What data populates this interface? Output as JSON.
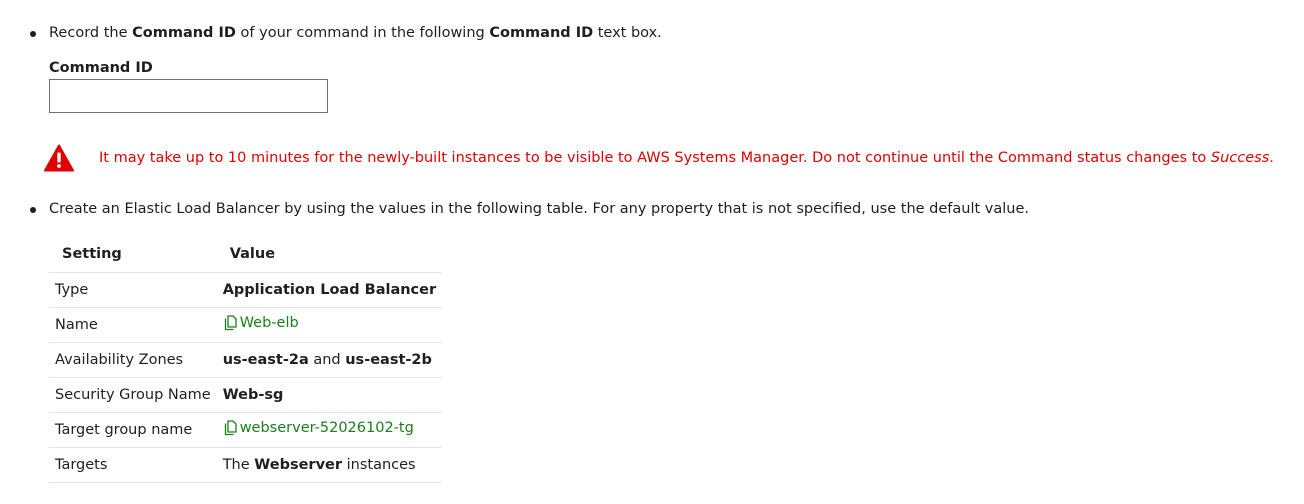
{
  "step1": {
    "t1": "Record the ",
    "b1": "Command ID",
    "t2": " of your command in the following ",
    "b2": "Command ID",
    "t3": " text box."
  },
  "field": {
    "label": "Command ID",
    "value": ""
  },
  "warning": {
    "icon": "warning-triangle-icon",
    "text": "It may take up to 10 minutes for the newly-built instances to be visible to AWS Systems Manager. Do not continue until the Command status changes to ",
    "emphasis": "Success",
    "end": ".",
    "color": "#e00000"
  },
  "step2": {
    "text": "Create an Elastic Load Balancer by using the values in the following table. For any property that is not specified, use the default value."
  },
  "table": {
    "headers": [
      "Setting",
      "Value"
    ],
    "rows": [
      {
        "setting": "Type",
        "value_bold": "Application Load Balancer"
      },
      {
        "setting": "Name",
        "value_copy": "Web-elb"
      },
      {
        "setting": "Availability Zones",
        "az1": "us-east-2a",
        "and": " and ",
        "az2": "us-east-2b"
      },
      {
        "setting": "Security Group Name",
        "value_bold": "Web-sg"
      },
      {
        "setting": "Target group name",
        "value_copy": "webserver-52026102-tg"
      },
      {
        "setting": "Targets",
        "pre": "The ",
        "bold": "Webserver",
        "post": " instances"
      }
    ]
  },
  "colors": {
    "copy_link": "#1a7f1a"
  }
}
